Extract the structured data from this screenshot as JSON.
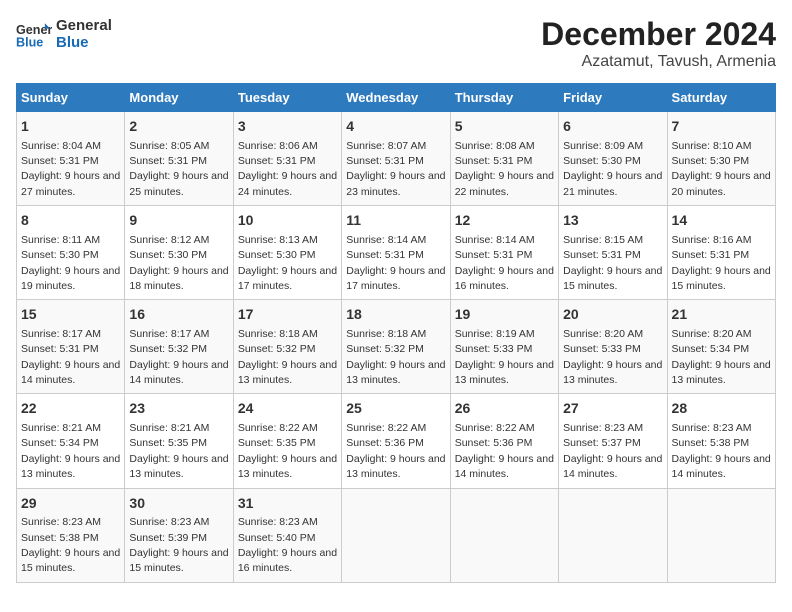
{
  "logo": {
    "line1": "General",
    "line2": "Blue"
  },
  "title": "December 2024",
  "subtitle": "Azatamut, Tavush, Armenia",
  "columns": [
    "Sunday",
    "Monday",
    "Tuesday",
    "Wednesday",
    "Thursday",
    "Friday",
    "Saturday"
  ],
  "weeks": [
    [
      {
        "day": "1",
        "sunrise": "8:04 AM",
        "sunset": "5:31 PM",
        "daylight": "9 hours and 27 minutes."
      },
      {
        "day": "2",
        "sunrise": "8:05 AM",
        "sunset": "5:31 PM",
        "daylight": "9 hours and 25 minutes."
      },
      {
        "day": "3",
        "sunrise": "8:06 AM",
        "sunset": "5:31 PM",
        "daylight": "9 hours and 24 minutes."
      },
      {
        "day": "4",
        "sunrise": "8:07 AM",
        "sunset": "5:31 PM",
        "daylight": "9 hours and 23 minutes."
      },
      {
        "day": "5",
        "sunrise": "8:08 AM",
        "sunset": "5:31 PM",
        "daylight": "9 hours and 22 minutes."
      },
      {
        "day": "6",
        "sunrise": "8:09 AM",
        "sunset": "5:30 PM",
        "daylight": "9 hours and 21 minutes."
      },
      {
        "day": "7",
        "sunrise": "8:10 AM",
        "sunset": "5:30 PM",
        "daylight": "9 hours and 20 minutes."
      }
    ],
    [
      {
        "day": "8",
        "sunrise": "8:11 AM",
        "sunset": "5:30 PM",
        "daylight": "9 hours and 19 minutes."
      },
      {
        "day": "9",
        "sunrise": "8:12 AM",
        "sunset": "5:30 PM",
        "daylight": "9 hours and 18 minutes."
      },
      {
        "day": "10",
        "sunrise": "8:13 AM",
        "sunset": "5:30 PM",
        "daylight": "9 hours and 17 minutes."
      },
      {
        "day": "11",
        "sunrise": "8:14 AM",
        "sunset": "5:31 PM",
        "daylight": "9 hours and 17 minutes."
      },
      {
        "day": "12",
        "sunrise": "8:14 AM",
        "sunset": "5:31 PM",
        "daylight": "9 hours and 16 minutes."
      },
      {
        "day": "13",
        "sunrise": "8:15 AM",
        "sunset": "5:31 PM",
        "daylight": "9 hours and 15 minutes."
      },
      {
        "day": "14",
        "sunrise": "8:16 AM",
        "sunset": "5:31 PM",
        "daylight": "9 hours and 15 minutes."
      }
    ],
    [
      {
        "day": "15",
        "sunrise": "8:17 AM",
        "sunset": "5:31 PM",
        "daylight": "9 hours and 14 minutes."
      },
      {
        "day": "16",
        "sunrise": "8:17 AM",
        "sunset": "5:32 PM",
        "daylight": "9 hours and 14 minutes."
      },
      {
        "day": "17",
        "sunrise": "8:18 AM",
        "sunset": "5:32 PM",
        "daylight": "9 hours and 13 minutes."
      },
      {
        "day": "18",
        "sunrise": "8:18 AM",
        "sunset": "5:32 PM",
        "daylight": "9 hours and 13 minutes."
      },
      {
        "day": "19",
        "sunrise": "8:19 AM",
        "sunset": "5:33 PM",
        "daylight": "9 hours and 13 minutes."
      },
      {
        "day": "20",
        "sunrise": "8:20 AM",
        "sunset": "5:33 PM",
        "daylight": "9 hours and 13 minutes."
      },
      {
        "day": "21",
        "sunrise": "8:20 AM",
        "sunset": "5:34 PM",
        "daylight": "9 hours and 13 minutes."
      }
    ],
    [
      {
        "day": "22",
        "sunrise": "8:21 AM",
        "sunset": "5:34 PM",
        "daylight": "9 hours and 13 minutes."
      },
      {
        "day": "23",
        "sunrise": "8:21 AM",
        "sunset": "5:35 PM",
        "daylight": "9 hours and 13 minutes."
      },
      {
        "day": "24",
        "sunrise": "8:22 AM",
        "sunset": "5:35 PM",
        "daylight": "9 hours and 13 minutes."
      },
      {
        "day": "25",
        "sunrise": "8:22 AM",
        "sunset": "5:36 PM",
        "daylight": "9 hours and 13 minutes."
      },
      {
        "day": "26",
        "sunrise": "8:22 AM",
        "sunset": "5:36 PM",
        "daylight": "9 hours and 14 minutes."
      },
      {
        "day": "27",
        "sunrise": "8:23 AM",
        "sunset": "5:37 PM",
        "daylight": "9 hours and 14 minutes."
      },
      {
        "day": "28",
        "sunrise": "8:23 AM",
        "sunset": "5:38 PM",
        "daylight": "9 hours and 14 minutes."
      }
    ],
    [
      {
        "day": "29",
        "sunrise": "8:23 AM",
        "sunset": "5:38 PM",
        "daylight": "9 hours and 15 minutes."
      },
      {
        "day": "30",
        "sunrise": "8:23 AM",
        "sunset": "5:39 PM",
        "daylight": "9 hours and 15 minutes."
      },
      {
        "day": "31",
        "sunrise": "8:23 AM",
        "sunset": "5:40 PM",
        "daylight": "9 hours and 16 minutes."
      },
      null,
      null,
      null,
      null
    ]
  ],
  "labels": {
    "sunrise": "Sunrise:",
    "sunset": "Sunset:",
    "daylight": "Daylight hours"
  }
}
